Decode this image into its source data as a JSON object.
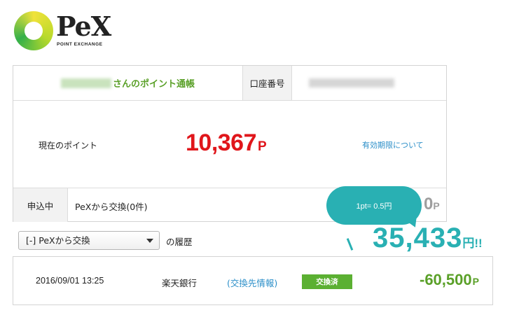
{
  "logo": {
    "wordmark": "PeX",
    "tagline": "POINT EXCHANGE"
  },
  "account": {
    "owner_suffix": "さんのポイント通帳",
    "account_number_label": "口座番号",
    "current_points_label": "現在のポイント",
    "current_points_value": "10,367",
    "points_unit": "P",
    "expiry_link": "有効期限について",
    "pending_label": "申込中",
    "pending_text": "PeXから交換(0件)",
    "pending_points": "0",
    "pending_unit": "P"
  },
  "bubble": {
    "text": "1pt= 0.5円"
  },
  "yen": {
    "value": "35,433",
    "unit": "円!!"
  },
  "history": {
    "selected_option": "[-] PeXから交換",
    "suffix": "の履歴",
    "rows": [
      {
        "date": "2016/09/01 13:25",
        "destination": "楽天銀行",
        "info_link": "(交換先情報)",
        "status": "交換済",
        "amount": "-60,500",
        "unit": "P"
      }
    ]
  },
  "colors": {
    "accent_green": "#5aa028",
    "points_red": "#e0161b",
    "teal": "#29b0b3",
    "link_blue": "#2a8ec8"
  }
}
